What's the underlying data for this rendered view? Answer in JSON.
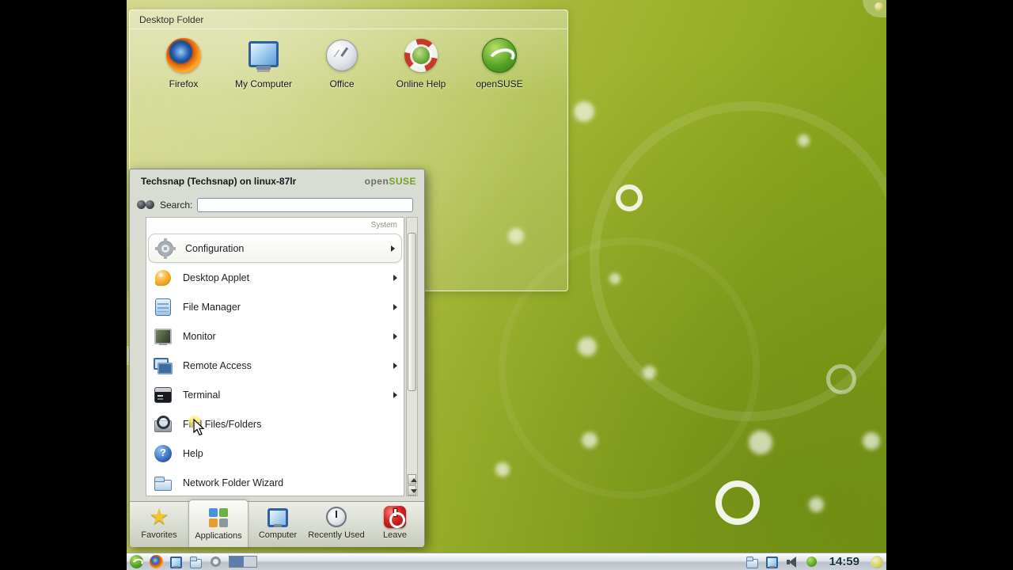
{
  "colors": {
    "suse_green": "#73ba25",
    "wallpaper_green": "#9eb32e",
    "leave_red": "#d42222"
  },
  "desktop_folder": {
    "title": "Desktop Folder",
    "icons": [
      {
        "label": "Firefox"
      },
      {
        "label": "My Computer"
      },
      {
        "label": "Office"
      },
      {
        "label": "Online Help"
      },
      {
        "label": "openSUSE"
      }
    ]
  },
  "kickoff": {
    "title": "Techsnap (Techsnap) on linux-87lr",
    "brand": {
      "open": "open",
      "suse": "SUSE"
    },
    "search_label": "Search:",
    "search_value": "",
    "category": "System",
    "glyphs": {
      "help": "?",
      "star": "★"
    },
    "items": [
      {
        "label": "Configuration",
        "has_submenu": true
      },
      {
        "label": "Desktop Applet",
        "has_submenu": true
      },
      {
        "label": "File Manager",
        "has_submenu": true
      },
      {
        "label": "Monitor",
        "has_submenu": true
      },
      {
        "label": "Remote Access",
        "has_submenu": true
      },
      {
        "label": "Terminal",
        "has_submenu": true
      },
      {
        "label": "Find Files/Folders",
        "has_submenu": false
      },
      {
        "label": "Help",
        "has_submenu": false
      },
      {
        "label": "Network Folder Wizard",
        "has_submenu": false
      }
    ],
    "tabs": [
      {
        "label": "Favorites",
        "active": false
      },
      {
        "label": "Applications",
        "active": true
      },
      {
        "label": "Computer",
        "active": false
      },
      {
        "label": "Recently Used",
        "active": false
      },
      {
        "label": "Leave",
        "active": false
      }
    ]
  },
  "taskbar": {
    "clock": "14:59"
  }
}
